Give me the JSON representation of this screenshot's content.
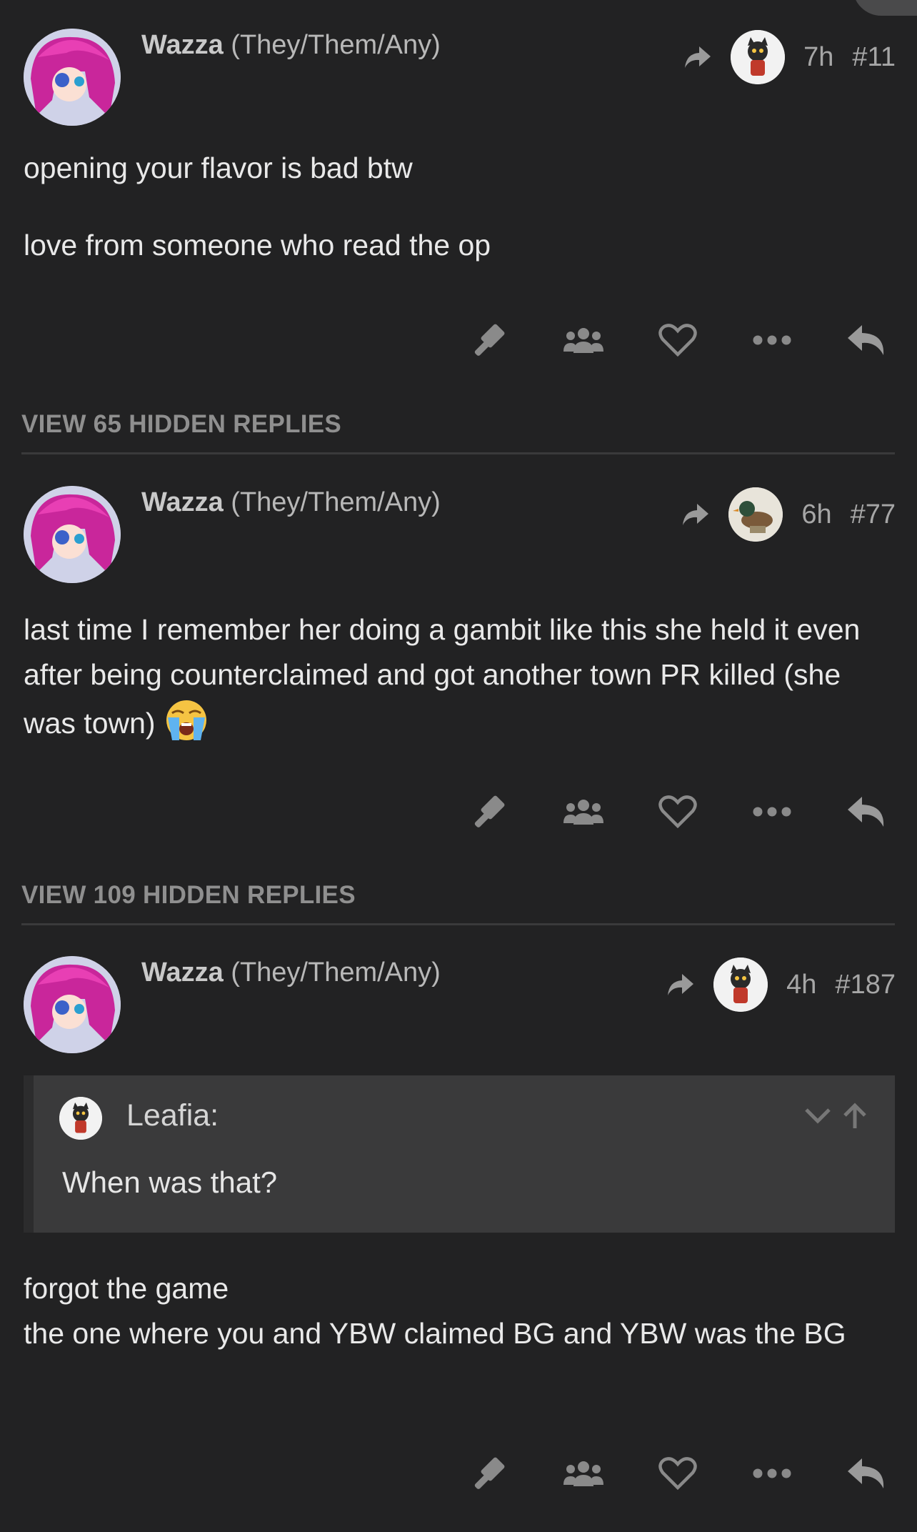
{
  "posts": [
    {
      "author": "Wazza",
      "pronouns": "(They/Them/Any)",
      "time": "7h",
      "number": "#11",
      "reply_to_avatar": "cat-avatar",
      "paragraphs": [
        "opening your flavor is bad btw",
        "love from someone who read the op"
      ]
    },
    {
      "author": "Wazza",
      "pronouns": "(They/Them/Any)",
      "time": "6h",
      "number": "#77",
      "reply_to_avatar": "duck-avatar",
      "paragraphs": [
        "last time I remember her doing a gambit like this she held it even after being counterclaimed and got another town PR killed (she was town)"
      ]
    },
    {
      "author": "Wazza",
      "pronouns": "(They/Them/Any)",
      "time": "4h",
      "number": "#187",
      "reply_to_avatar": "cat-avatar",
      "quote": {
        "author": "Leafia:",
        "text": "When was that?"
      },
      "paragraphs": [
        "forgot the game",
        "the one where you and YBW claimed BG and YBW was the BG"
      ]
    }
  ],
  "hidden_replies": [
    "VIEW 65 HIDDEN REPLIES",
    "VIEW 109 HIDDEN REPLIES"
  ],
  "emoji": "loudly-crying-face-emoji",
  "actions": [
    "gavel-icon",
    "users-icon",
    "heart-icon",
    "more-icon",
    "reply-icon"
  ],
  "colors": {
    "background": "#222223",
    "quote_bg": "#3a3a3b",
    "muted": "#8f8f8f",
    "icon": "#8a8a8a"
  }
}
